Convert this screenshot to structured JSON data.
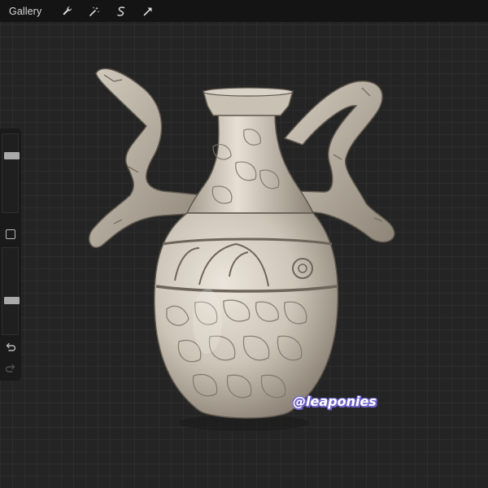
{
  "topbar": {
    "gallery_label": "Gallery",
    "tools": [
      "wrench-icon",
      "magic-wand-icon",
      "selection-s-icon",
      "transform-arrow-icon"
    ]
  },
  "sidebar": {
    "brush_size_level": 0.74,
    "opacity_level": 0.37
  },
  "canvas": {
    "subject": "stone amphora vase",
    "watermark": "@leaponies"
  },
  "colors": {
    "canvas_bg": "#242424",
    "toolbar_bg": "#141414",
    "stone_light": "#d8d1c6",
    "stone_shadow": "#8a8174",
    "watermark_outline": "#6e63c9"
  }
}
